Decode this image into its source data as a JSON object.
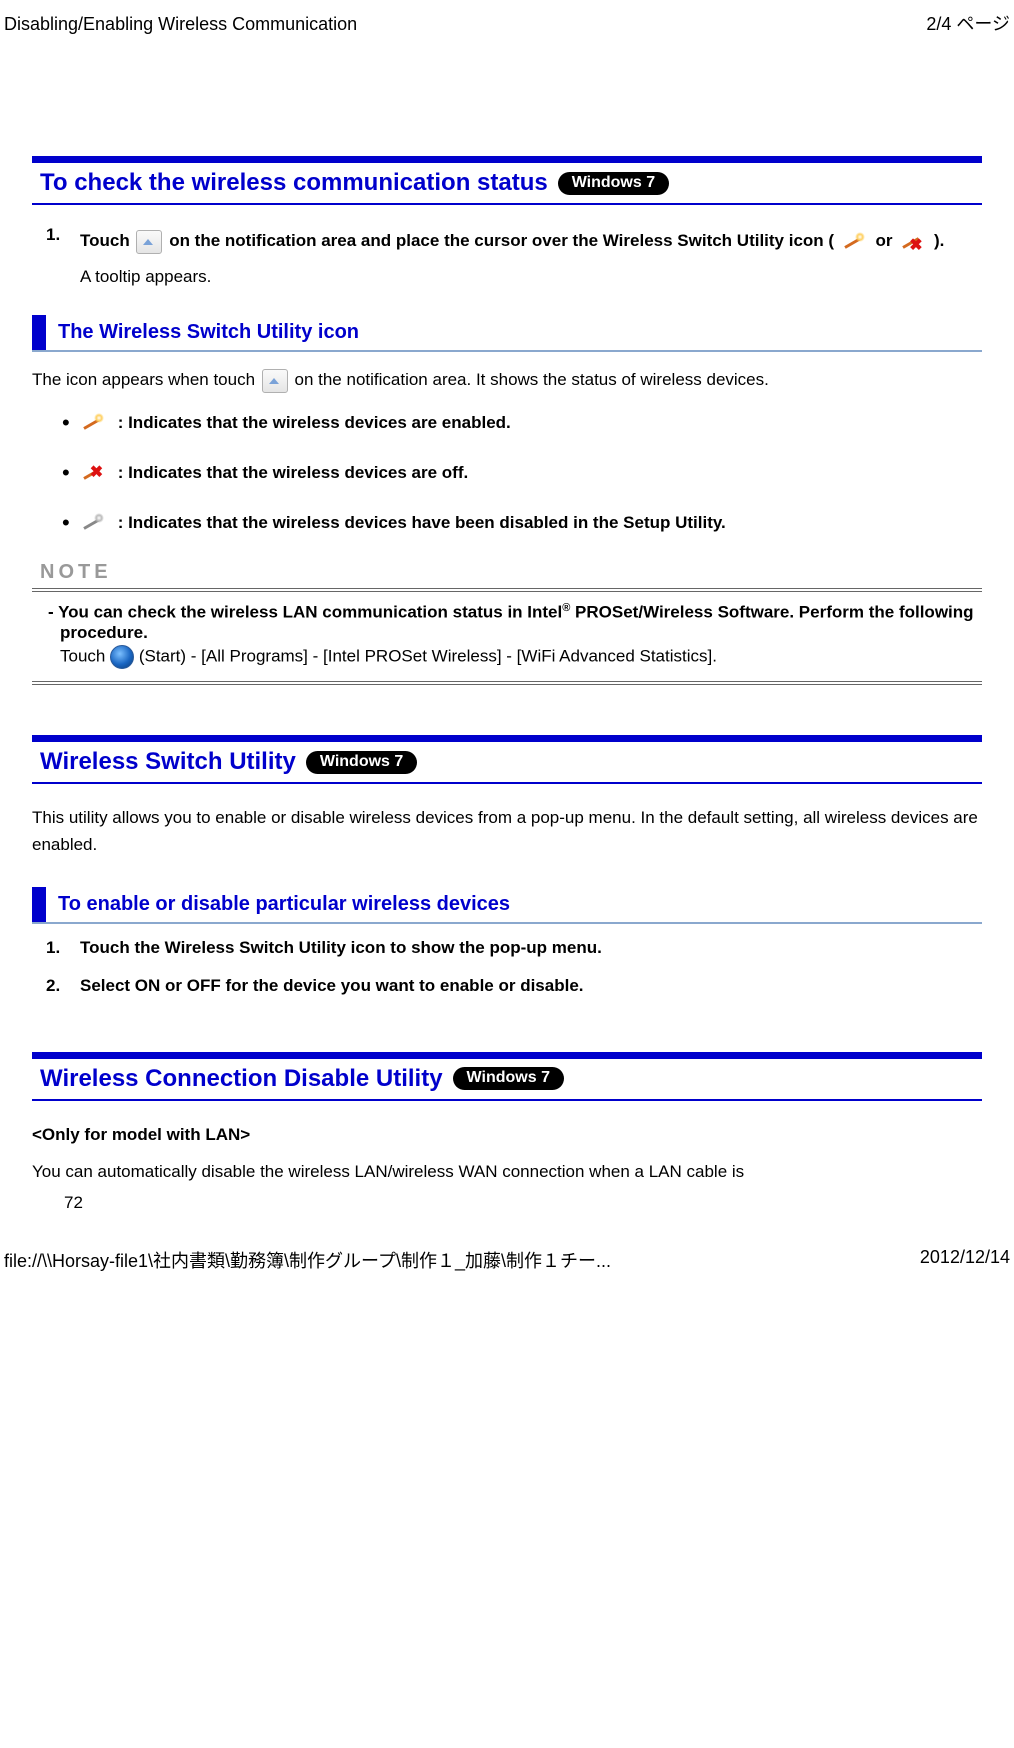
{
  "header": {
    "title": "Disabling/Enabling Wireless Communication",
    "page_indicator": "2/4 ページ"
  },
  "section1": {
    "title": "To check the wireless communication status",
    "badge": "Windows 7",
    "step1_num": "1.",
    "step1_a": "Touch ",
    "step1_b": " on the notification area and place the cursor over the Wireless Switch Utility icon ( ",
    "step1_c": " or ",
    "step1_d": " ).",
    "step1_sub": "A tooltip appears."
  },
  "section2": {
    "title": "The Wireless Switch Utility icon",
    "para_a": "The icon appears when touch ",
    "para_b": " on the notification area. It shows the status of wireless devices.",
    "b1": " : Indicates that the wireless devices are enabled.",
    "b2": " : Indicates that the wireless devices are off.",
    "b3": " : Indicates that the wireless devices have been disabled in the Setup Utility."
  },
  "note": {
    "label": "NOTE",
    "line1_a": "- You can check the wireless LAN communication status in Intel",
    "line1_sup": "®",
    "line1_b": " PROSet/Wireless Software. Perform the following procedure.",
    "line2_a": "Touch ",
    "line2_b": " (Start) - [All Programs] - [Intel PROSet Wireless] - [WiFi Advanced Statistics]."
  },
  "section3": {
    "title": "Wireless Switch Utility",
    "badge": "Windows 7",
    "para": "This utility allows you to enable or disable wireless devices from a pop-up menu. In the default setting, all wireless devices are enabled."
  },
  "section4": {
    "title": "To enable or disable particular wireless devices",
    "s1_num": "1.",
    "s1": "Touch the Wireless Switch Utility icon to show the pop-up menu.",
    "s2_num": "2.",
    "s2": "Select ON or OFF for the device you want to enable or disable."
  },
  "section5": {
    "title": "Wireless Connection Disable Utility",
    "badge": "Windows 7",
    "sub": "<Only for model with LAN>",
    "para": "You can automatically disable the wireless LAN/wireless WAN connection when a LAN cable is"
  },
  "page_number": "72",
  "footer": {
    "path": "file://\\\\Horsay-file1\\社内書類\\勤務簿\\制作グループ\\制作１_加藤\\制作１チー...",
    "date": "2012/12/14"
  }
}
